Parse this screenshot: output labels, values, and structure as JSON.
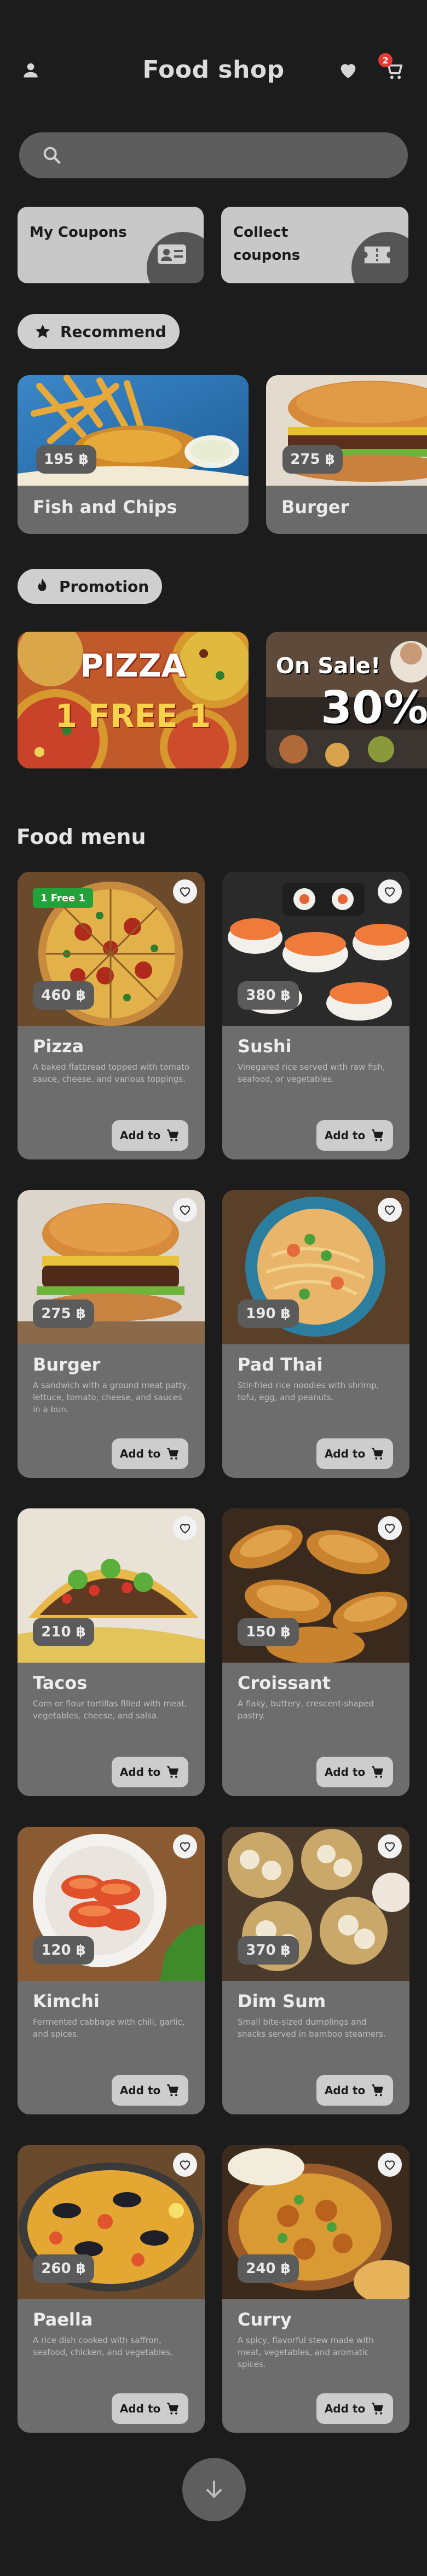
{
  "header": {
    "title": "Food shop",
    "cart_badge": "2",
    "icons": [
      "person-icon",
      "heart-icon",
      "cart-icon"
    ]
  },
  "search": {
    "placeholder": ""
  },
  "coupons": {
    "my_coupons": "My Coupons",
    "collect_coupons": "Collect coupons"
  },
  "recommend": {
    "label": "Recommend",
    "items": [
      {
        "name": "Fish and Chips",
        "price": "195 ฿"
      },
      {
        "name": "Burger",
        "price": "275 ฿"
      }
    ]
  },
  "promotion": {
    "label": "Promotion",
    "banners": [
      {
        "line1": "PIZZA",
        "line2": "1 FREE 1"
      },
      {
        "line1": "On Sale!",
        "line2": "30%"
      }
    ]
  },
  "menu": {
    "title": "Food menu",
    "add_label": "Add to",
    "items": [
      {
        "name": "Pizza",
        "price": "460 ฿",
        "tag": "1 Free 1",
        "desc": "A baked flatbread topped with tomato sauce, cheese, and various toppings."
      },
      {
        "name": "Sushi",
        "price": "380 ฿",
        "desc": "Vinegared rice served with raw fish, seafood, or vegetables."
      },
      {
        "name": "Burger",
        "price": "275 ฿",
        "desc": "A sandwich with a ground meat patty, lettuce, tomato, cheese, and sauces in a bun."
      },
      {
        "name": "Pad Thai",
        "price": "190 ฿",
        "desc": "Stir-fried rice noodles with shrimp, tofu, egg, and peanuts."
      },
      {
        "name": "Tacos",
        "price": "210 ฿",
        "desc": "Corn or flour tortillas filled with meat, vegetables, cheese, and salsa."
      },
      {
        "name": "Croissant",
        "price": "150 ฿",
        "desc": "A flaky, buttery, crescent-shaped pastry."
      },
      {
        "name": "Kimchi",
        "price": "120 ฿",
        "desc": "Fermented cabbage with chili, garlic, and spices."
      },
      {
        "name": "Dim Sum",
        "price": "370 ฿",
        "desc": "Small bite-sized dumplings and snacks served in bamboo steamers."
      },
      {
        "name": "Paella",
        "price": "260 ฿",
        "desc": "A rice dish cooked with saffron, seafood, chicken, and vegetables."
      },
      {
        "name": "Curry",
        "price": "240 ฿",
        "desc": "A spicy, flavorful stew made with meat, vegetables, and aromatic spices."
      }
    ]
  },
  "colors": {
    "background": "#1c1c1c",
    "card": "#6d6d6d",
    "badge": "#e53935",
    "tag": "#22a33a"
  }
}
